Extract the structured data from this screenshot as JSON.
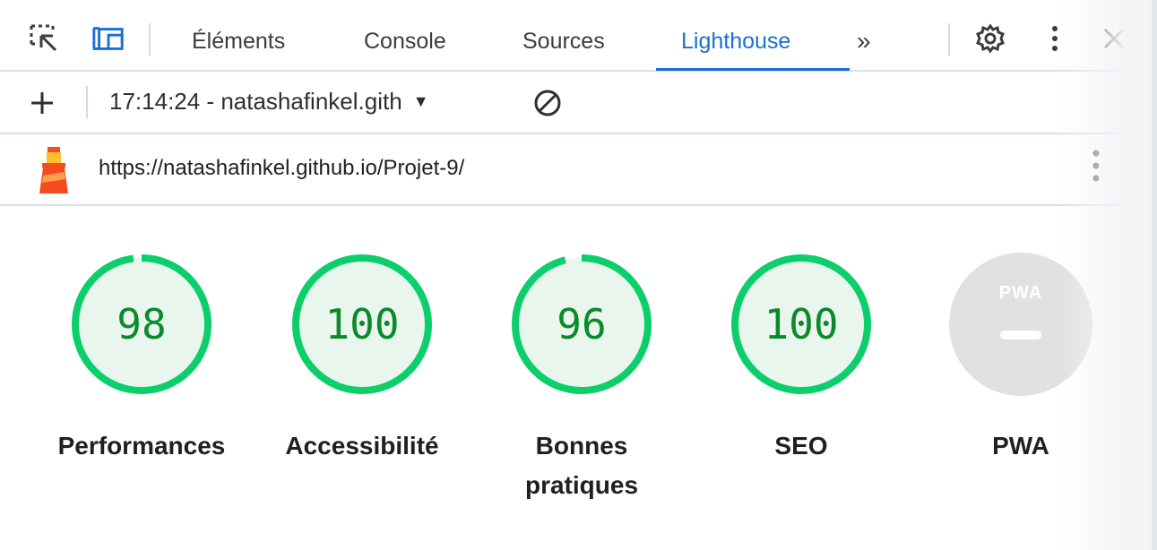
{
  "tabs": [
    {
      "label": "Éléments",
      "active": false
    },
    {
      "label": "Console",
      "active": false
    },
    {
      "label": "Sources",
      "active": false
    },
    {
      "label": "Lighthouse",
      "active": true
    }
  ],
  "toolbar": {
    "more_tabs_glyph": "»",
    "icons": [
      "inspect-element-icon",
      "device-toolbar-icon",
      "chevron-double-right-icon",
      "gear-icon",
      "kebab-menu-icon",
      "close-icon"
    ]
  },
  "report": {
    "selected": "17:14:24 - natashafinkel.gith",
    "dropdown_glyph": "▼"
  },
  "url": {
    "text": "https://natashafinkel.github.io/Projet-9/"
  },
  "scores": [
    {
      "value": "98",
      "label": "Performances",
      "fraction": 0.98
    },
    {
      "value": "100",
      "label": "Accessibilité",
      "fraction": 1.0
    },
    {
      "value": "96",
      "label": "Bonnes pratiques",
      "fraction": 0.96
    },
    {
      "value": "100",
      "label": "SEO",
      "fraction": 1.0
    }
  ],
  "pwa": {
    "badge_text": "PWA",
    "label": "PWA"
  },
  "colors": {
    "accent": "#1a6fd1",
    "score_pass": "#0cce6b",
    "score_text": "#0a8a2a",
    "score_bg": "#e9f6ee"
  }
}
